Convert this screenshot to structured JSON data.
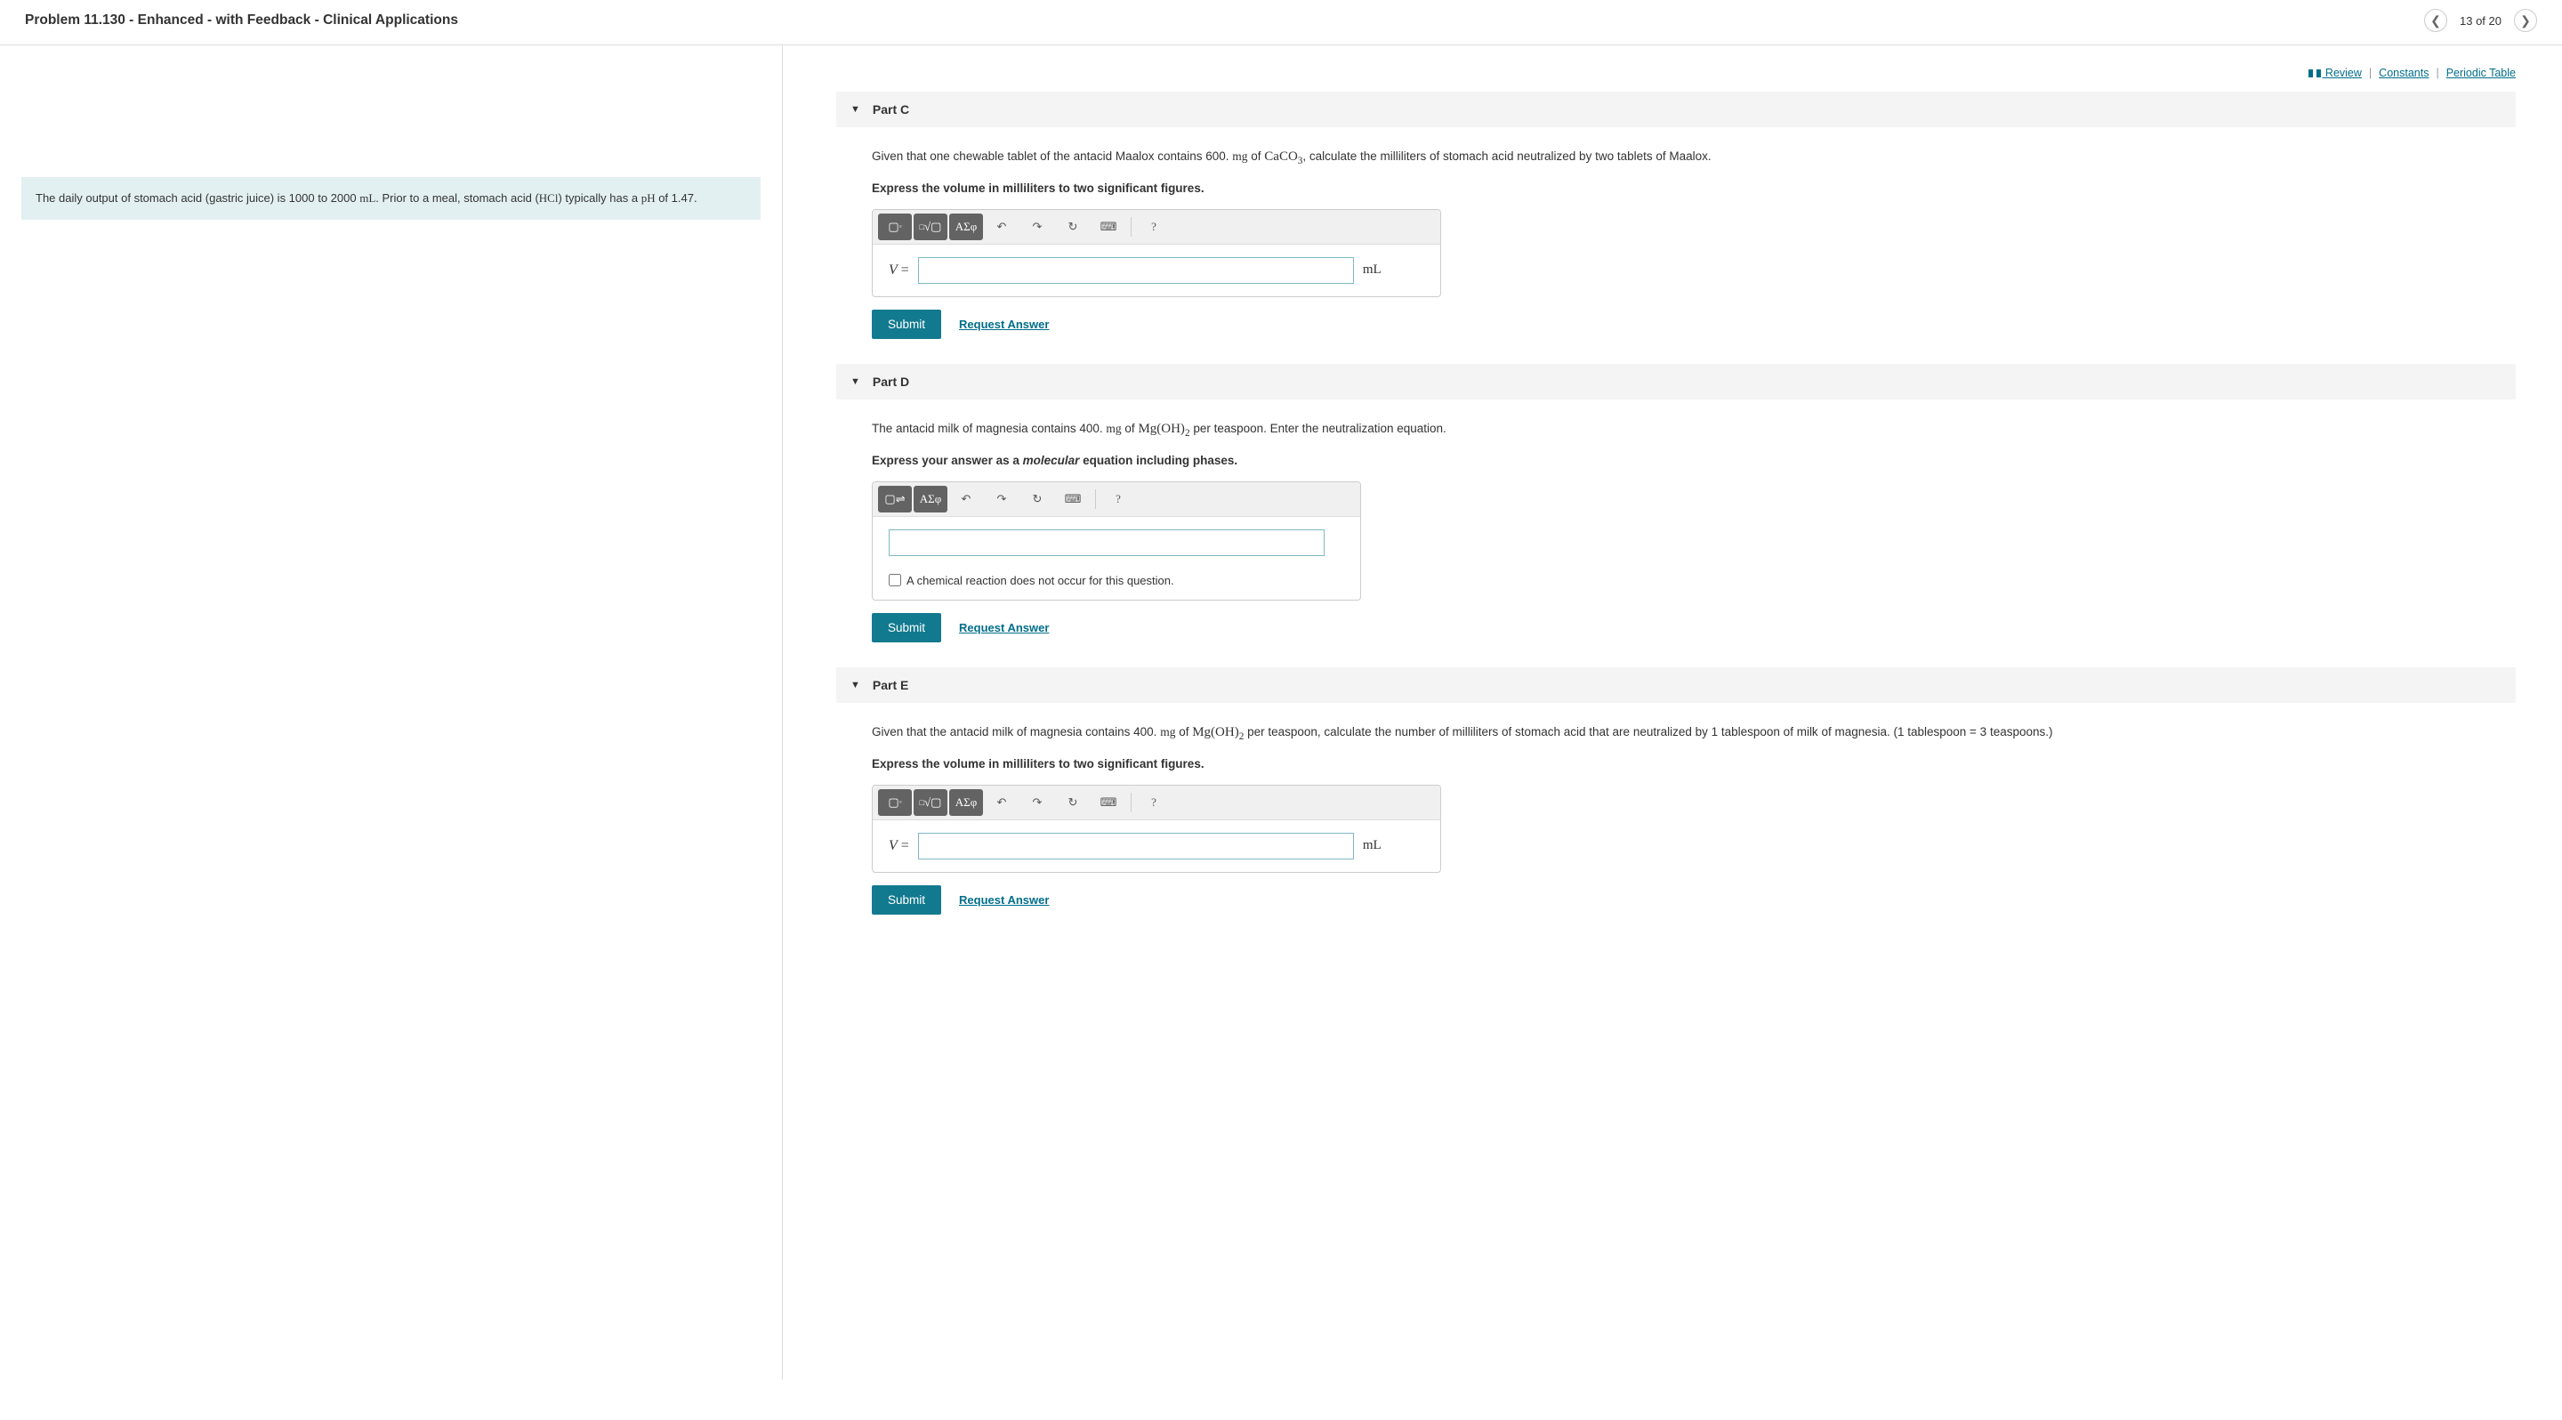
{
  "header": {
    "title": "Problem 11.130  - Enhanced - with Feedback - Clinical Applications",
    "pagination": "13 of 20"
  },
  "links": {
    "review": " Review",
    "constants": "Constants",
    "periodic": "Periodic Table"
  },
  "info_box": {
    "pre1": "The daily output of stomach acid (gastric juice) is 1000 to 2000 ",
    "unit1": "mL",
    "mid1": ". Prior to a meal, stomach acid ",
    "hcl_open": "(",
    "hcl": "HCl",
    "hcl_close": ")",
    "mid2": " typically has a ",
    "ph_label": "pH",
    "end": " of 1.47."
  },
  "partC": {
    "title": "Part C",
    "q_pre": "Given that one chewable tablet of the antacid Maalox contains 600. ",
    "q_mg": "mg",
    "q_of": " of ",
    "q_chem": "CaCO",
    "q_chem_sub": "3",
    "q_post": ", calculate the milliliters of stomach acid neutralized by two tablets of Maalox.",
    "instruction": "Express the volume in milliliters to two significant figures.",
    "var": "V",
    "eq": " = ",
    "unit": "mL",
    "submit": "Submit",
    "request": "Request Answer"
  },
  "partD": {
    "title": "Part D",
    "q_pre": "The antacid milk of magnesia contains 400. ",
    "q_mg": "mg",
    "q_of": " of ",
    "q_chem1": "Mg(OH)",
    "q_chem1_sub": "2",
    "q_post": " per teaspoon. Enter the neutralization equation.",
    "instruction_pre": "Express your answer as a ",
    "instruction_em": "molecular",
    "instruction_post": " equation including phases.",
    "checkbox": "A chemical reaction does not occur for this question.",
    "submit": "Submit",
    "request": "Request Answer"
  },
  "partE": {
    "title": "Part E",
    "q_pre": "Given that the antacid milk of magnesia contains 400. ",
    "q_mg": "mg",
    "q_of": " of ",
    "q_chem1": "Mg(OH)",
    "q_chem1_sub": "2",
    "q_post": " per teaspoon, calculate the number of milliliters of stomach acid that are neutralized by 1 tablespoon of milk of magnesia. (1 tablespoon = 3 teaspoons.)",
    "instruction": "Express the volume in milliliters to two significant figures.",
    "var": "V",
    "eq": " = ",
    "unit": "mL",
    "submit": "Submit",
    "request": "Request Answer"
  },
  "toolbar": {
    "greek": "ΑΣφ",
    "help": "?"
  }
}
